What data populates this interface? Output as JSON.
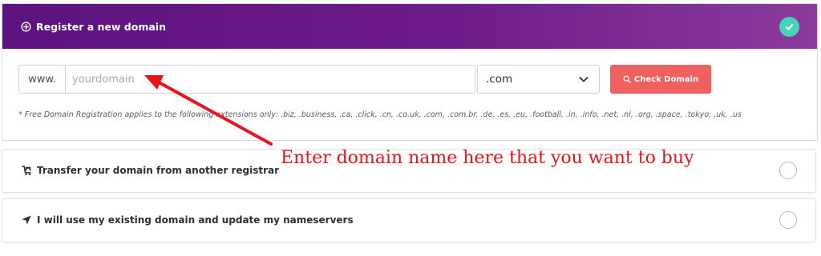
{
  "register_panel": {
    "title": "Register a new domain",
    "icon": "plus-circle-icon",
    "selected_icon": "check-circle-icon",
    "www_prefix": "www.",
    "domain_input": {
      "value": "",
      "placeholder": "yourdomain"
    },
    "tld_select": {
      "selected": ".com"
    },
    "check_button_label": "Check Domain",
    "free_note": "* Free Domain Registration applies to the following extensions only: .biz, .business, .ca, .click, .cn, .co.uk, .com, .com.br, .de, .es, .eu, .football, .in, .info, .net, .nl, .org, .space, .tokyo, .uk, .us"
  },
  "options": [
    {
      "label": "Transfer your domain from another registrar",
      "icon": "transfer-icon"
    },
    {
      "label": "I will use my existing domain and update my nameservers",
      "icon": "location-arrow-icon"
    }
  ],
  "annotation": {
    "text": "Enter domain name here that you want to buy"
  },
  "colors": {
    "header_gradient_start": "#5b137f",
    "header_gradient_end": "#8d3a9d",
    "check_badge": "#48d3b8",
    "check_button": "#f0605e",
    "annotation_red": "#e8141b"
  }
}
